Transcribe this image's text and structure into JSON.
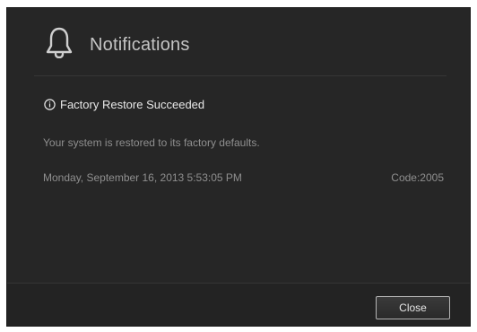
{
  "dialog": {
    "title": "Notifications",
    "icon": "bell-icon"
  },
  "notification": {
    "icon": "info-circle-icon",
    "title": "Factory Restore Succeeded",
    "message": "Your system is restored to its factory defaults.",
    "timestamp": "Monday, September 16, 2013 5:53:05 PM",
    "code": "Code:2005"
  },
  "footer": {
    "close_label": "Close"
  },
  "colors": {
    "background": "#262626",
    "title_text": "#c4c4c4",
    "secondary_text": "#8f8f8f"
  }
}
